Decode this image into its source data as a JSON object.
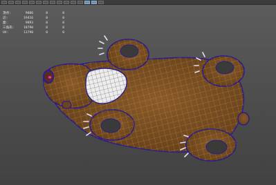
{
  "toolbar": {
    "icons": [
      "select-icon",
      "lasso-icon",
      "paint-icon",
      "move-icon",
      "rotate-icon",
      "scale-icon",
      "snap-grid-icon",
      "snap-curve-icon",
      "snap-point-icon",
      "snap-view-icon",
      "render-icon",
      "ipr-icon",
      "settings-icon",
      "shade-icon",
      "wireframe-icon"
    ]
  },
  "hud": {
    "rows": [
      {
        "label": "頂点:",
        "v1": "9886",
        "v2": "0",
        "v3": "0"
      },
      {
        "label": "辺:",
        "v1": "19416",
        "v2": "0",
        "v3": "0"
      },
      {
        "label": "面:",
        "v1": "9893",
        "v2": "0",
        "v3": "0"
      },
      {
        "label": "三角形:",
        "v1": "18790",
        "v2": "0",
        "v3": "0"
      },
      {
        "label": "UV:",
        "v1": "13790",
        "v2": "0",
        "v3": "0"
      }
    ]
  },
  "colors": {
    "fur": "#7a4e24",
    "wire": "#c79a2e",
    "edge": "#2b1d8a",
    "chest": "#ededed",
    "pad": "#3a3a3a"
  }
}
